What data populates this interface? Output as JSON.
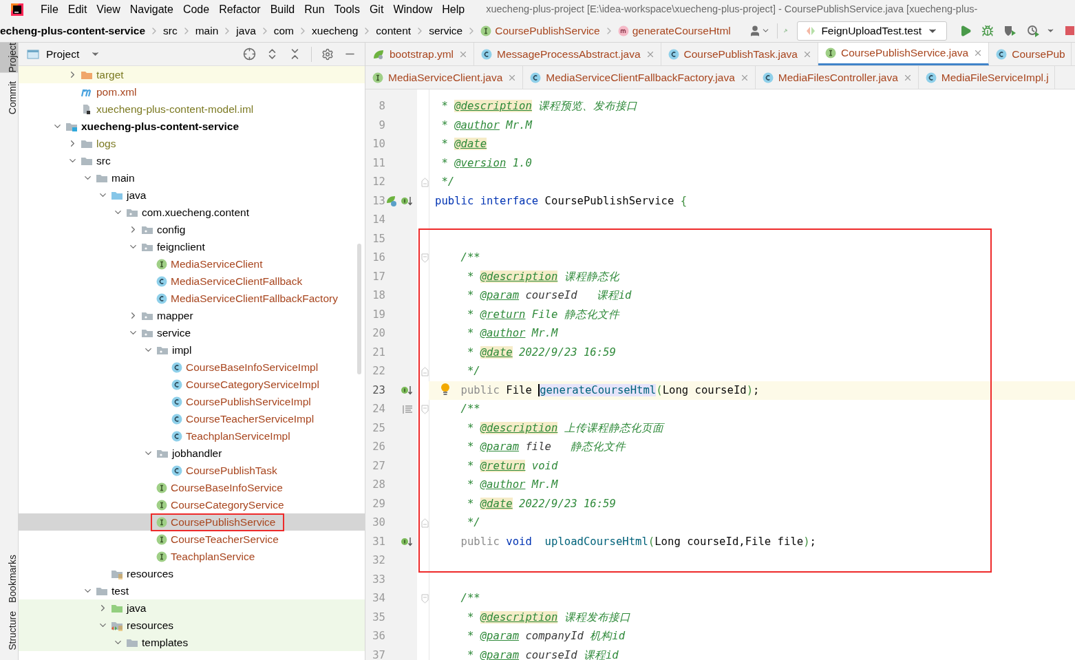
{
  "menu": {
    "items": [
      "File",
      "Edit",
      "View",
      "Navigate",
      "Code",
      "Refactor",
      "Build",
      "Run",
      "Tools",
      "Git",
      "Window",
      "Help"
    ],
    "title": "xuecheng-plus-project [E:\\idea-workspace\\xuecheng-plus-project] - CoursePublishService.java [xuecheng-plus-"
  },
  "navbar": {
    "crumbs": [
      {
        "label": "echeng-plus-content-service",
        "kind": "module"
      },
      {
        "label": "src",
        "kind": "folder"
      },
      {
        "label": "main",
        "kind": "folder"
      },
      {
        "label": "java",
        "kind": "folder"
      },
      {
        "label": "com",
        "kind": "folder"
      },
      {
        "label": "xuecheng",
        "kind": "folder"
      },
      {
        "label": "content",
        "kind": "folder"
      },
      {
        "label": "service",
        "kind": "folder"
      },
      {
        "label": "CoursePublishService",
        "kind": "interface"
      },
      {
        "label": "generateCourseHtml",
        "kind": "method"
      }
    ],
    "run_config": "FeignUploadTest.test"
  },
  "sidebar_tabs": {
    "top": [
      {
        "label": "Project",
        "selected": true
      },
      {
        "label": "Commit",
        "selected": false
      }
    ],
    "bottom": [
      {
        "label": "Bookmarks",
        "selected": false
      },
      {
        "label": "Structure",
        "selected": false
      }
    ]
  },
  "project_panel": {
    "title": "Project",
    "tree": [
      {
        "kind": "hidden-parent",
        "children": [
          {
            "label": "target",
            "kind": "excluded",
            "color": "#7c7a23",
            "expanded": false,
            "selected": false
          },
          {
            "label": "pom.xml",
            "kind": "maven",
            "color": "#a8461f",
            "selected": false
          },
          {
            "label": "xuecheng-plus-content-model.iml",
            "kind": "iml",
            "color": "#7c7a23",
            "selected": false
          }
        ]
      },
      {
        "label": "xuecheng-plus-content-service",
        "kind": "module",
        "expanded": true,
        "selected": false,
        "children": [
          {
            "label": "logs",
            "kind": "folder",
            "color": "#7c7a23",
            "expanded": false,
            "selected": false
          },
          {
            "label": "src",
            "kind": "folder",
            "expanded": true,
            "selected": false,
            "children": [
              {
                "label": "main",
                "kind": "folder",
                "expanded": true,
                "selected": false,
                "children": [
                  {
                    "label": "java",
                    "kind": "source",
                    "expanded": true,
                    "selected": false,
                    "children": [
                      {
                        "label": "com.xuecheng.content",
                        "kind": "package",
                        "expanded": true,
                        "selected": false,
                        "children": [
                          {
                            "label": "config",
                            "kind": "package",
                            "expanded": false,
                            "selected": false
                          },
                          {
                            "label": "feignclient",
                            "kind": "package",
                            "expanded": true,
                            "selected": false,
                            "children": [
                              {
                                "label": "MediaServiceClient",
                                "kind": "interface",
                                "color": "#a8461f",
                                "selected": false
                              },
                              {
                                "label": "MediaServiceClientFallback",
                                "kind": "class",
                                "color": "#a8461f",
                                "selected": false
                              },
                              {
                                "label": "MediaServiceClientFallbackFactory",
                                "kind": "class",
                                "color": "#a8461f",
                                "selected": false
                              }
                            ]
                          },
                          {
                            "label": "mapper",
                            "kind": "package",
                            "expanded": false,
                            "selected": false
                          },
                          {
                            "label": "service",
                            "kind": "package",
                            "expanded": true,
                            "selected": false,
                            "children": [
                              {
                                "label": "impl",
                                "kind": "package",
                                "expanded": true,
                                "selected": false,
                                "children": [
                                  {
                                    "label": "CourseBaseInfoServiceImpl",
                                    "kind": "class",
                                    "color": "#a8461f",
                                    "selected": false
                                  },
                                  {
                                    "label": "CourseCategoryServiceImpl",
                                    "kind": "class",
                                    "color": "#a8461f",
                                    "selected": false
                                  },
                                  {
                                    "label": "CoursePublishServiceImpl",
                                    "kind": "class",
                                    "color": "#a8461f",
                                    "selected": false
                                  },
                                  {
                                    "label": "CourseTeacherServiceImpl",
                                    "kind": "class",
                                    "color": "#a8461f",
                                    "selected": false
                                  },
                                  {
                                    "label": "TeachplanServiceImpl",
                                    "kind": "class",
                                    "color": "#a8461f",
                                    "selected": false
                                  }
                                ]
                              },
                              {
                                "label": "jobhandler",
                                "kind": "package",
                                "expanded": true,
                                "selected": false,
                                "children": [
                                  {
                                    "label": "CoursePublishTask",
                                    "kind": "class",
                                    "color": "#a8461f",
                                    "selected": false
                                  }
                                ]
                              },
                              {
                                "label": "CourseBaseInfoService",
                                "kind": "interface",
                                "color": "#a8461f",
                                "selected": false
                              },
                              {
                                "label": "CourseCategoryService",
                                "kind": "interface",
                                "color": "#a8461f",
                                "selected": false
                              },
                              {
                                "label": "CoursePublishService",
                                "kind": "interface",
                                "color": "#a8461f",
                                "selected": true,
                                "annotated": true
                              },
                              {
                                "label": "CourseTeacherService",
                                "kind": "interface",
                                "color": "#a8461f",
                                "selected": false
                              },
                              {
                                "label": "TeachplanService",
                                "kind": "interface",
                                "color": "#a8461f",
                                "selected": false
                              }
                            ]
                          }
                        ]
                      }
                    ]
                  },
                  {
                    "label": "resources",
                    "kind": "resources",
                    "selected": false
                  }
                ]
              },
              {
                "label": "test",
                "kind": "folder",
                "expanded": true,
                "selected": false,
                "children": [
                  {
                    "label": "java",
                    "kind": "test-source",
                    "test_scope": true,
                    "expanded": false,
                    "selected": false
                  },
                  {
                    "label": "resources",
                    "kind": "test-resources",
                    "test_scope": true,
                    "expanded": true,
                    "selected": false,
                    "children": [
                      {
                        "label": "templates",
                        "kind": "folder",
                        "test_scope": true,
                        "expanded": true,
                        "selected": false
                      }
                    ]
                  }
                ]
              }
            ]
          }
        ]
      }
    ]
  },
  "editor": {
    "tab_rows": [
      [
        {
          "label": "bootstrap.yml",
          "kind": "leaf",
          "selected": false,
          "cut": false
        },
        {
          "label": "MessageProcessAbstract.java",
          "kind": "class",
          "selected": false,
          "cut": false
        },
        {
          "label": "CoursePublishTask.java",
          "kind": "class",
          "selected": false,
          "cut": false
        },
        {
          "label": "CoursePublishService.java",
          "kind": "interface",
          "selected": true,
          "cut": false
        },
        {
          "label": "CoursePub",
          "kind": "class",
          "selected": false,
          "cut": true
        }
      ],
      [
        {
          "label": "MediaServiceClient.java",
          "kind": "interface",
          "selected": false,
          "cut": false
        },
        {
          "label": "MediaServiceClientFallbackFactory.java",
          "kind": "class",
          "selected": false,
          "cut": false
        },
        {
          "label": "MediaFilesController.java",
          "kind": "class",
          "selected": false,
          "cut": false
        },
        {
          "label": "MediaFileServiceImpl.j",
          "kind": "class",
          "selected": false,
          "cut": true
        }
      ]
    ],
    "lines": [
      {
        "number": "8",
        "current": false,
        "tokens": [
          {
            "kind": "c",
            "text": " * "
          },
          {
            "kind": "tagm",
            "text": "@description"
          },
          {
            "kind": "c",
            "text": " 课程预览、发布接口"
          }
        ]
      },
      {
        "number": "9",
        "current": false,
        "tokens": [
          {
            "kind": "c",
            "text": " * "
          },
          {
            "kind": "tag",
            "text": "@author"
          },
          {
            "kind": "c",
            "text": " Mr.M"
          }
        ]
      },
      {
        "number": "10",
        "current": false,
        "tokens": [
          {
            "kind": "c",
            "text": " * "
          },
          {
            "kind": "tagm",
            "text": "@date"
          }
        ]
      },
      {
        "number": "11",
        "current": false,
        "tokens": [
          {
            "kind": "c",
            "text": " * "
          },
          {
            "kind": "tag",
            "text": "@version"
          },
          {
            "kind": "c",
            "text": " 1.0"
          }
        ]
      },
      {
        "number": "12",
        "current": false,
        "fold": {
          "kind": "end"
        },
        "tokens": [
          {
            "kind": "c",
            "text": " */"
          }
        ]
      },
      {
        "number": "13",
        "current": false,
        "gutter": {
          "kind": "spring-implemented"
        },
        "tokens": [
          {
            "kind": "kw",
            "text": "public"
          },
          {
            "kind": "kw",
            "text": " interface"
          },
          {
            "kind": "t",
            "text": " CoursePublishService "
          },
          {
            "kind": "p",
            "text": "{"
          }
        ]
      },
      {
        "number": "14",
        "current": false
      },
      {
        "number": "15",
        "current": false
      },
      {
        "number": "16",
        "current": false,
        "fold": {
          "kind": "start"
        },
        "tokens": [
          {
            "kind": "c",
            "text": "    /**"
          }
        ]
      },
      {
        "number": "17",
        "current": false,
        "tokens": [
          {
            "kind": "c",
            "text": "     * "
          },
          {
            "kind": "tagm",
            "text": "@description"
          },
          {
            "kind": "c",
            "text": " 课程静态化"
          }
        ]
      },
      {
        "number": "18",
        "current": false,
        "tokens": [
          {
            "kind": "c",
            "text": "     * "
          },
          {
            "kind": "tag",
            "text": "@param"
          },
          {
            "kind": "cp",
            "text": " courseId   "
          },
          {
            "kind": "c",
            "text": "课程id"
          }
        ]
      },
      {
        "number": "19",
        "current": false,
        "tokens": [
          {
            "kind": "c",
            "text": "     * "
          },
          {
            "kind": "tag",
            "text": "@return"
          },
          {
            "kind": "c",
            "text": " File 静态化文件"
          }
        ]
      },
      {
        "number": "20",
        "current": false,
        "tokens": [
          {
            "kind": "c",
            "text": "     * "
          },
          {
            "kind": "tag",
            "text": "@author"
          },
          {
            "kind": "c",
            "text": " Mr.M"
          }
        ]
      },
      {
        "number": "21",
        "current": false,
        "tokens": [
          {
            "kind": "c",
            "text": "     * "
          },
          {
            "kind": "tagm",
            "text": "@date"
          },
          {
            "kind": "c",
            "text": " 2022/9/23 16:59"
          }
        ]
      },
      {
        "number": "22",
        "current": false,
        "fold": {
          "kind": "end"
        },
        "tokens": [
          {
            "kind": "c",
            "text": "     */"
          }
        ]
      },
      {
        "number": "23",
        "current": true,
        "gutter": {
          "kind": "implemented"
        },
        "bulb": true,
        "tokens": [
          {
            "kind": "mod",
            "text": "    public"
          },
          {
            "kind": "t",
            "text": " File "
          },
          {
            "kind": "fnc",
            "text": "generateCourseHtml"
          },
          {
            "kind": "p",
            "text": "("
          },
          {
            "kind": "t",
            "text": "Long courseId"
          },
          {
            "kind": "p",
            "text": ")"
          },
          {
            "kind": "t",
            "text": ";"
          }
        ]
      },
      {
        "number": "24",
        "current": false,
        "gutter": {
          "kind": "list"
        },
        "fold": {
          "kind": "start"
        },
        "tokens": [
          {
            "kind": "c",
            "text": "    /**"
          }
        ]
      },
      {
        "number": "25",
        "current": false,
        "tokens": [
          {
            "kind": "c",
            "text": "     * "
          },
          {
            "kind": "tagm",
            "text": "@description"
          },
          {
            "kind": "c",
            "text": " 上传课程静态化页面"
          }
        ]
      },
      {
        "number": "26",
        "current": false,
        "tokens": [
          {
            "kind": "c",
            "text": "     * "
          },
          {
            "kind": "tag",
            "text": "@param"
          },
          {
            "kind": "cp",
            "text": " file   "
          },
          {
            "kind": "c",
            "text": "静态化文件"
          }
        ]
      },
      {
        "number": "27",
        "current": false,
        "tokens": [
          {
            "kind": "c",
            "text": "     * "
          },
          {
            "kind": "tagm",
            "text": "@return"
          },
          {
            "kind": "c",
            "text": " void"
          }
        ]
      },
      {
        "number": "28",
        "current": false,
        "tokens": [
          {
            "kind": "c",
            "text": "     * "
          },
          {
            "kind": "tag",
            "text": "@author"
          },
          {
            "kind": "c",
            "text": " Mr.M"
          }
        ]
      },
      {
        "number": "29",
        "current": false,
        "tokens": [
          {
            "kind": "c",
            "text": "     * "
          },
          {
            "kind": "tagm",
            "text": "@date"
          },
          {
            "kind": "c",
            "text": " 2022/9/23 16:59"
          }
        ]
      },
      {
        "number": "30",
        "current": false,
        "fold": {
          "kind": "end"
        },
        "tokens": [
          {
            "kind": "c",
            "text": "     */"
          }
        ]
      },
      {
        "number": "31",
        "current": false,
        "gutter": {
          "kind": "implemented"
        },
        "tokens": [
          {
            "kind": "mod",
            "text": "    public"
          },
          {
            "kind": "kw",
            "text": " void"
          },
          {
            "kind": "fn",
            "text": "  uploadCourseHtml"
          },
          {
            "kind": "p",
            "text": "("
          },
          {
            "kind": "t",
            "text": "Long courseId,File file"
          },
          {
            "kind": "p",
            "text": ")"
          },
          {
            "kind": "t",
            "text": ";"
          }
        ]
      },
      {
        "number": "32",
        "current": false
      },
      {
        "number": "33",
        "current": false
      },
      {
        "number": "34",
        "current": false,
        "fold": {
          "kind": "start"
        },
        "tokens": [
          {
            "kind": "c",
            "text": "    /**"
          }
        ]
      },
      {
        "number": "35",
        "current": false,
        "tokens": [
          {
            "kind": "c",
            "text": "     * "
          },
          {
            "kind": "tagm",
            "text": "@description"
          },
          {
            "kind": "c",
            "text": " 课程发布接口"
          }
        ]
      },
      {
        "number": "36",
        "current": false,
        "tokens": [
          {
            "kind": "c",
            "text": "     * "
          },
          {
            "kind": "tag",
            "text": "@param"
          },
          {
            "kind": "cp",
            "text": " companyId "
          },
          {
            "kind": "c",
            "text": "机构id"
          }
        ]
      },
      {
        "number": "37",
        "current": false,
        "tokens": [
          {
            "kind": "c",
            "text": "     * "
          },
          {
            "kind": "tag",
            "text": "@param"
          },
          {
            "kind": "cp",
            "text": " courseId "
          },
          {
            "kind": "c",
            "text": "课程id"
          }
        ]
      }
    ]
  }
}
